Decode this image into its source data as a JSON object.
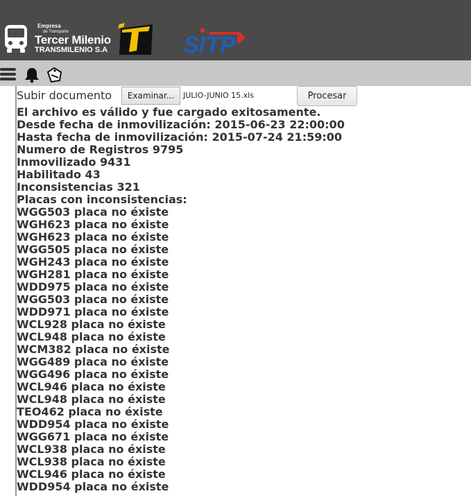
{
  "header": {
    "company_line1": "Empresa",
    "company_line2": "de Transporte",
    "company_line3": "Tercer Milenio",
    "company_line4": "TRANSMILENIO S.A",
    "sitp_logo_text": "SITP"
  },
  "toolbar": {
    "icons": [
      "menu-icon",
      "bell-icon",
      "tag-icon"
    ]
  },
  "upload": {
    "label": "Subir documento",
    "browse_label": "Examinar...",
    "file_name": "JULIO-JUNIO 15.xls",
    "process_label": "Procesar"
  },
  "summary": {
    "valid_message": "El archivo es válido y fue cargado exitosamente.",
    "from_date": "Desde fecha de inmovilización: 2015-06-23 22:00:00",
    "to_date": "Hasta fecha de inmovilización: 2015-07-24 21:59:00",
    "records": "Numero de Registros 9795",
    "immobilized": "Inmovilizado 9431",
    "enabled": "Habilitado 43",
    "inconsistencies": "Inconsistencias 321",
    "plates_header": "Placas con inconsistencias:"
  },
  "plates": [
    "WGG503 placa no éxiste",
    "WGH623 placa no éxiste",
    "WGH623 placa no éxiste",
    "WGG505 placa no éxiste",
    "WGH243 placa no éxiste",
    "WGH281 placa no éxiste",
    "WDD975 placa no éxiste",
    "WGG503 placa no éxiste",
    "WDD971 placa no éxiste",
    "WCL928 placa no éxiste",
    "WCL948 placa no éxiste",
    "WCM382 placa no éxiste",
    "WGG489 placa no éxiste",
    "WGG496 placa no éxiste",
    "WCL946 placa no éxiste",
    "WCL948 placa no éxiste",
    "TEO462 placa no éxiste",
    "WDD954 placa no éxiste",
    "WGG671 placa no éxiste",
    "WCL938 placa no éxiste",
    "WCL938 placa no éxiste",
    "WCL946 placa no éxiste",
    "WDD954 placa no éxiste"
  ],
  "colors": {
    "header_bg": "#4a4a4a",
    "toolbar_bg": "#c7c7c7",
    "sitp_blue": "#1f5fb4",
    "sitp_red": "#d0312d",
    "logo_yellow": "#f2c200"
  }
}
